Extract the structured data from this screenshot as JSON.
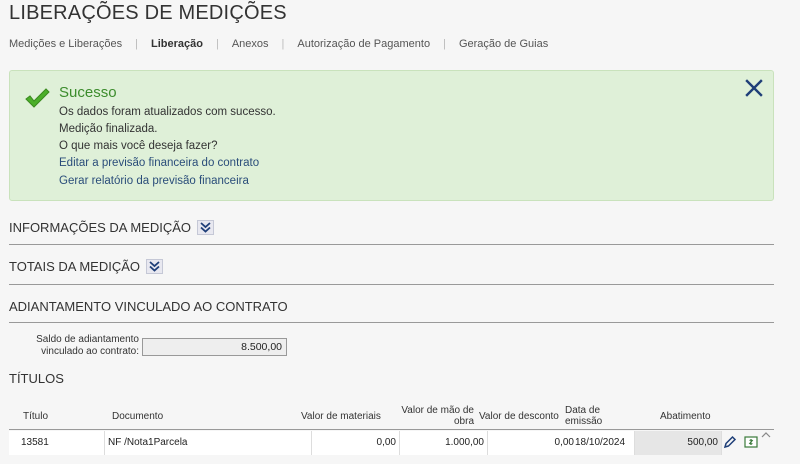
{
  "page": {
    "title": "LIBERAÇÕES DE MEDIÇÕES"
  },
  "tabs": [
    {
      "label": "Medições e Liberações"
    },
    {
      "label": "Liberação",
      "active": true
    },
    {
      "label": "Anexos"
    },
    {
      "label": "Autorização de Pagamento"
    },
    {
      "label": "Geração de Guias"
    }
  ],
  "alert": {
    "title": "Sucesso",
    "lines": [
      "Os dados foram atualizados com sucesso.",
      "Medição finalizada.",
      "O que mais você deseja fazer?"
    ],
    "links": [
      "Editar a previsão financeira do contrato",
      "Gerar relatório da previsão financeira"
    ],
    "color": "#dff0d8"
  },
  "sections": {
    "info": "INFORMAÇÕES DA MEDIÇÃO",
    "totais": "TOTAIS DA MEDIÇÃO",
    "adiantamento": "ADIANTAMENTO VINCULADO AO CONTRATO",
    "titulos": "TÍTULOS"
  },
  "adiantamento": {
    "saldo_label": "Saldo de adiantamento vinculado ao contrato:",
    "saldo_value": "8.500,00"
  },
  "table": {
    "headers": {
      "titulo": "Título",
      "documento": "Documento",
      "valor_materiais": "Valor de materiais",
      "valor_mao_obra": "Valor de mão de obra",
      "valor_desconto": "Valor de desconto",
      "data_emissao": "Data de emissão",
      "abatimento": "Abatimento"
    },
    "rows": [
      {
        "titulo": "13581",
        "documento": "NF /Nota1Parcela",
        "valor_materiais": "0,00",
        "valor_mao_obra": "1.000,00",
        "valor_desconto": "0,00",
        "data_emissao": "18/10/2024",
        "abatimento": "500,00"
      }
    ]
  },
  "icons": {
    "success": "check-icon",
    "close": "close-icon",
    "expand": "chevron-double-down-icon",
    "edit": "pencil-icon",
    "money": "money-icon"
  }
}
